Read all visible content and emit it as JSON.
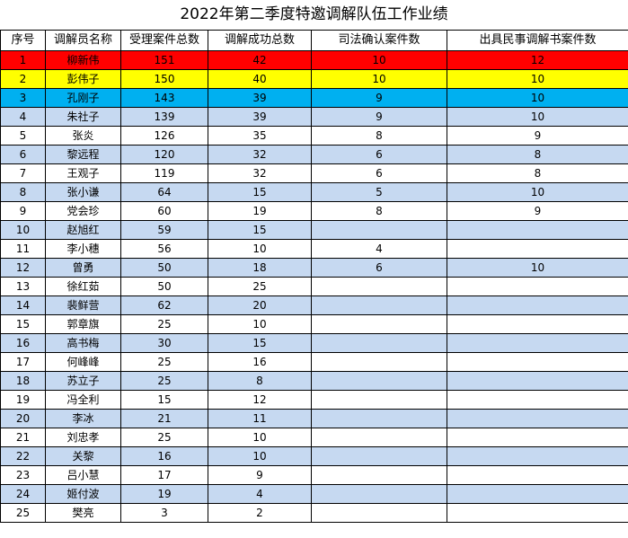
{
  "title": "2022年第二季度特邀调解队伍工作业绩",
  "colors": {
    "rank1": "#ff0000",
    "rank2": "#ffff00",
    "rank3": "#00b0f0",
    "stripe": "#c6d9f1",
    "white": "#ffffff"
  },
  "headers": [
    "序号",
    "调解员名称",
    "受理案件总数",
    "调解成功总数",
    "司法确认案件数",
    "出具民事调解书案件数"
  ],
  "rows": [
    [
      "1",
      "柳新伟",
      "151",
      "42",
      "10",
      "12"
    ],
    [
      "2",
      "彭伟子",
      "150",
      "40",
      "10",
      "10"
    ],
    [
      "3",
      "孔刚子",
      "143",
      "39",
      "9",
      "10"
    ],
    [
      "4",
      "朱社子",
      "139",
      "39",
      "9",
      "10"
    ],
    [
      "5",
      "张炎",
      "126",
      "35",
      "8",
      "9"
    ],
    [
      "6",
      "黎远程",
      "120",
      "32",
      "6",
      "8"
    ],
    [
      "7",
      "王观子",
      "119",
      "32",
      "6",
      "8"
    ],
    [
      "8",
      "张小谦",
      "64",
      "15",
      "5",
      "10"
    ],
    [
      "9",
      "党会珍",
      "60",
      "19",
      "8",
      "9"
    ],
    [
      "10",
      "赵旭红",
      "59",
      "15",
      "",
      ""
    ],
    [
      "11",
      "李小穗",
      "56",
      "10",
      "4",
      ""
    ],
    [
      "12",
      "曾勇",
      "50",
      "18",
      "6",
      "10"
    ],
    [
      "13",
      "徐红茹",
      "50",
      "25",
      "",
      ""
    ],
    [
      "14",
      "裴鲜营",
      "62",
      "20",
      "",
      ""
    ],
    [
      "15",
      "郭章旗",
      "25",
      "10",
      "",
      ""
    ],
    [
      "16",
      "高书梅",
      "30",
      "15",
      "",
      ""
    ],
    [
      "17",
      "何峰峰",
      "25",
      "16",
      "",
      ""
    ],
    [
      "18",
      "苏立子",
      "25",
      "8",
      "",
      ""
    ],
    [
      "19",
      "冯全利",
      "15",
      "12",
      "",
      ""
    ],
    [
      "20",
      "李冰",
      "21",
      "11",
      "",
      ""
    ],
    [
      "21",
      "刘忠孝",
      "25",
      "10",
      "",
      ""
    ],
    [
      "22",
      "关黎",
      "16",
      "10",
      "",
      ""
    ],
    [
      "23",
      "吕小慧",
      "17",
      "9",
      "",
      ""
    ],
    [
      "24",
      "姬付波",
      "19",
      "4",
      "",
      ""
    ],
    [
      "25",
      "樊亮",
      "3",
      "2",
      "",
      ""
    ]
  ]
}
